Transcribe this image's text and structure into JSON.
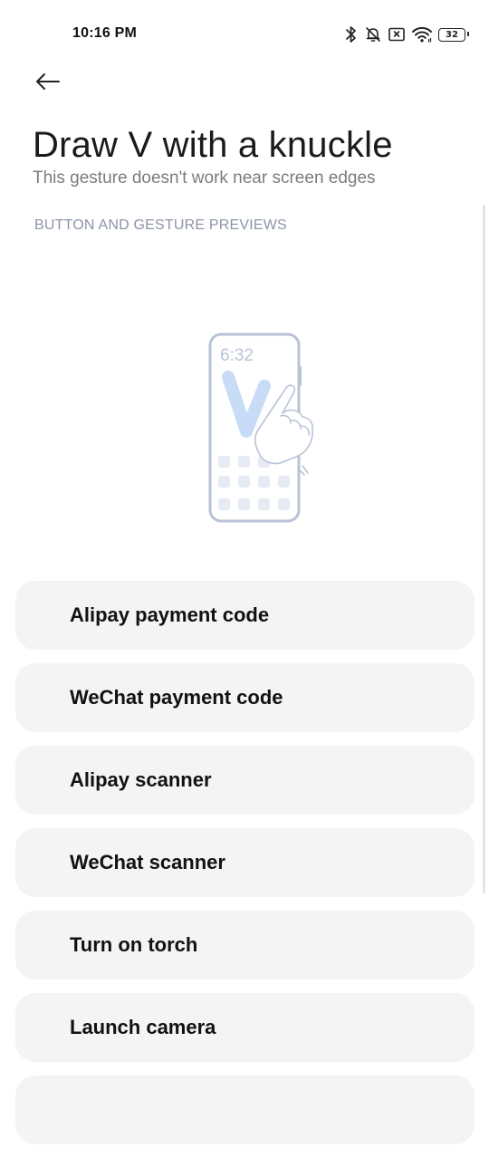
{
  "status_bar": {
    "time": "10:16 PM",
    "battery": "32",
    "icons": [
      "bluetooth-icon",
      "bell-muted-icon",
      "sim-off-icon",
      "wifi-icon",
      "battery-icon"
    ]
  },
  "header": {
    "back_icon": "arrow-left-icon",
    "title": "Draw V with a knuckle",
    "subtitle": "This gesture doesn't work near screen edges"
  },
  "section": {
    "header": "BUTTON AND GESTURE PREVIEWS"
  },
  "preview": {
    "clock": "6:32",
    "accent_color": "#c9dcf7",
    "outline_color": "#b9c3d6"
  },
  "options": [
    {
      "label": "Alipay payment code"
    },
    {
      "label": "WeChat payment code"
    },
    {
      "label": "Alipay scanner"
    },
    {
      "label": "WeChat scanner"
    },
    {
      "label": "Turn on torch"
    },
    {
      "label": "Launch camera"
    }
  ]
}
